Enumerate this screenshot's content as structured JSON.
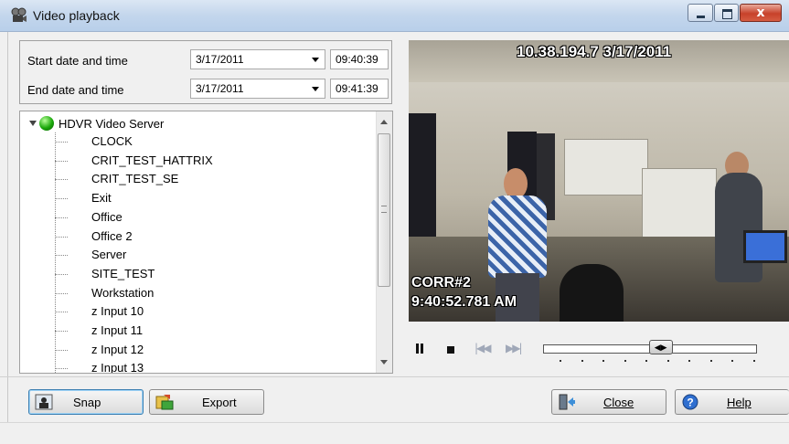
{
  "window": {
    "title": "Video playback",
    "close_glyph": "x"
  },
  "range": {
    "start_label": "Start date and time",
    "start_date": "3/17/2011",
    "start_time": "09:40:39",
    "end_label": "End date and time",
    "end_date": "3/17/2011",
    "end_time": "09:41:39"
  },
  "tree": {
    "root": "HDVR Video Server",
    "items": [
      "CLOCK",
      "CRIT_TEST_HATTRIX",
      "CRIT_TEST_SE",
      "Exit",
      "Office",
      "Office 2",
      "Server",
      "SITE_TEST",
      "Workstation",
      "z Input 10",
      "z Input 11",
      "z Input 12",
      "z Input 13"
    ]
  },
  "video": {
    "header_overlay": "10.38.194.7  3/17/2011",
    "camera_overlay": "CORR#2",
    "time_overlay": "9:40:52.781 AM"
  },
  "player": {
    "position_fraction": 0.55
  },
  "buttons": {
    "snap": "Snap",
    "export": "Export",
    "close": "Close",
    "help": "Help"
  },
  "icons": {
    "app": "camera-reel-icon",
    "server": "green-status-icon",
    "snap": "camera-snapshot-icon",
    "export": "export-icon",
    "close": "exit-door-icon",
    "help": "help-icon"
  }
}
